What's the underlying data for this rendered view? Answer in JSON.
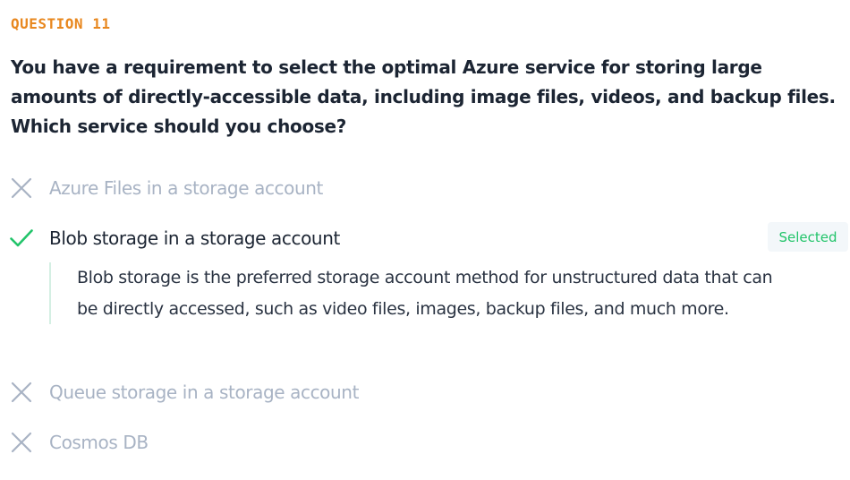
{
  "question": {
    "number_label": "QUESTION 11",
    "text": "You have a requirement to select the optimal Azure service for storing large amounts of directly-accessible data, including image files, videos, and backup files. Which service should you choose?"
  },
  "options": [
    {
      "label": "Azure Files in a storage account",
      "status": "incorrect",
      "icon": "x-icon"
    },
    {
      "label": "Blob storage in a storage account",
      "status": "correct",
      "icon": "checkmark-icon",
      "badge": "Selected"
    },
    {
      "label": "Queue storage in a storage account",
      "status": "incorrect",
      "icon": "x-icon"
    },
    {
      "label": "Cosmos DB",
      "status": "incorrect",
      "icon": "x-icon"
    }
  ],
  "explanation": {
    "text": "Blob storage is the preferred storage account method for unstructured data that can be directly accessed, such as video files, images, backup files, and much more."
  },
  "colors": {
    "question_number": "#e8871e",
    "correct": "#22c46a",
    "incorrect_text": "#a8b3c4",
    "badge_background": "#f3f7fa",
    "explanation_border": "#d4efe3"
  }
}
